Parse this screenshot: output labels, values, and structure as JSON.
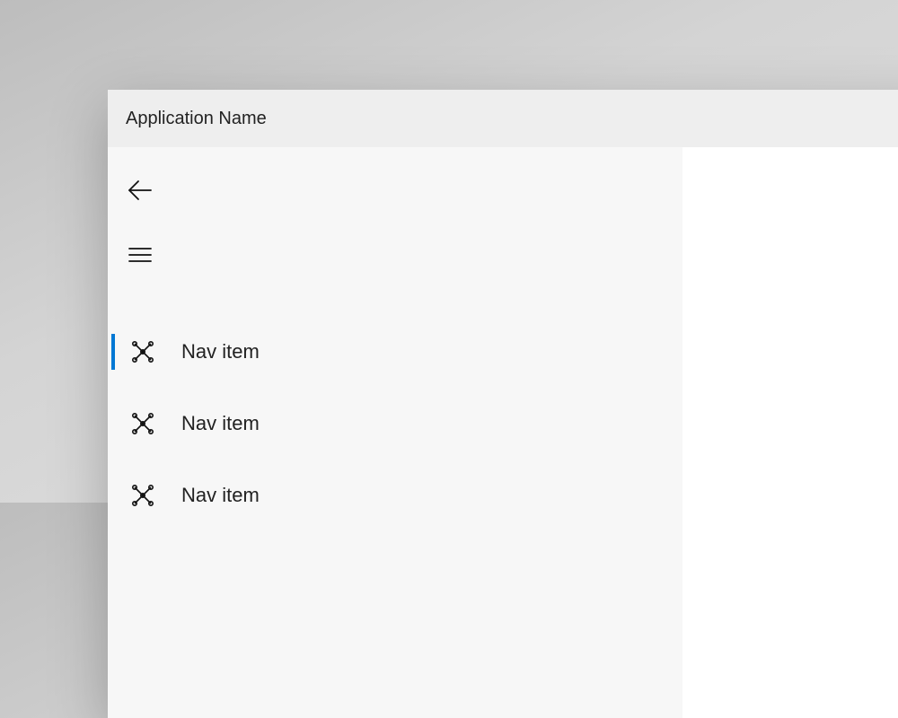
{
  "window": {
    "title": "Application Name"
  },
  "nav": {
    "items": [
      {
        "label": "Nav item",
        "selected": true
      },
      {
        "label": "Nav item",
        "selected": false
      },
      {
        "label": "Nav item",
        "selected": false
      }
    ]
  },
  "colors": {
    "accent": "#0078d4"
  }
}
